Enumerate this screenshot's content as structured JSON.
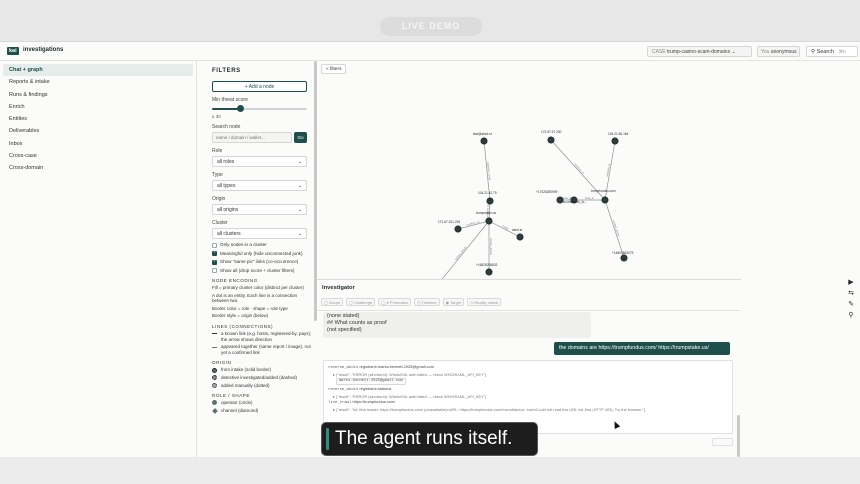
{
  "banner": {
    "pill_text": "LIVE DEMO"
  },
  "header": {
    "logo": "kai",
    "app_title": "investigations",
    "case_caption": "CASE",
    "case_value": "trump-casino-scam-domains",
    "case_chevron": "⌄",
    "user_caption": "You",
    "user_value": "anonymous",
    "search_label": "Search",
    "search_shortcut": "⌘K"
  },
  "nav": {
    "items": [
      "Chat + graph",
      "Reports & intake",
      "Runs & findings",
      "Enrich",
      "Entities",
      "Deliverables",
      "Inbox",
      "Cross-case",
      "Cross-domain"
    ],
    "active_index": 0
  },
  "filters": {
    "title": "FILTERS",
    "add_node": "+ Add a node",
    "min_threat_label": "Min threat score",
    "min_threat_value": 30,
    "min_threat_max": 100,
    "min_threat_readout": "≥ 30",
    "search_label": "Search node",
    "search_placeholder": "name / domain / wallet...",
    "go_label": "Go",
    "role_label": "Role",
    "role_value": "all roles",
    "type_label": "Type",
    "type_value": "all types",
    "origin_label": "Origin",
    "origin_value": "all origins",
    "cluster_label": "Cluster",
    "cluster_value": "all clusters",
    "checkboxes": [
      {
        "label": "Only nodes in a cluster",
        "checked": false
      },
      {
        "label": "Meaningful only (hide unconnected junk)",
        "checked": true
      },
      {
        "label": "Show \"same pic\" links (co-occurrence)",
        "checked": true
      },
      {
        "label": "Show all (drop score + cluster filters)",
        "checked": false
      }
    ],
    "encoding_title": "NODE ENCODING",
    "encoding_lines": [
      "Fill = primary cluster color (distinct per cluster)",
      "A dot is an entity. Each line is a connection between two.",
      "Border color = role · shape = role type",
      "Border style = origin (below)"
    ],
    "lines_title": "LINES (CONNECTIONS)",
    "lines_items": [
      "a known link (e.g. hosts, registered-by, pays); the arrow shows direction",
      "appeared together (same report / image), not yet a confirmed link"
    ],
    "origin_title": "ORIGIN",
    "origin_items": [
      "from intake (solid border)",
      "detective investigated/added (dashed)",
      "added manually (dotted)"
    ],
    "role_shape_title": "ROLE / SHAPE",
    "role_shape_items": [
      "operator (circle)",
      "channel (diamond)"
    ]
  },
  "graph": {
    "tab_label": "« filters",
    "nodes": [
      {
        "id": "n1",
        "label": "test@abcd.st"
      },
      {
        "id": "n2",
        "label": "172.67.97.230"
      },
      {
        "id": "n3",
        "label": "104.21.66.164"
      },
      {
        "id": "n4",
        "label": "trumpfundus.com"
      },
      {
        "id": "n5",
        "label": "+17028250999"
      },
      {
        "id": "n6",
        "label": "sn.escrituck_to..."
      },
      {
        "id": "n7",
        "label": "104.21.42.75"
      },
      {
        "id": "n8",
        "label": "trumpstake.us"
      },
      {
        "id": "n9",
        "label": "172.67.201.226"
      },
      {
        "id": "n10",
        "label": "abcd.st"
      },
      {
        "id": "n11",
        "label": "+14803563279"
      },
      {
        "id": "n12",
        "label": "+16852044170"
      },
      {
        "id": "n13",
        "label": "+16826208832"
      }
    ],
    "edges": [
      {
        "from": "n1",
        "to": "n7",
        "label": "registrant_email"
      },
      {
        "from": "n7",
        "to": "n8",
        "label": "resolves_to"
      },
      {
        "from": "n8",
        "to": "n9",
        "label": "resolves_to"
      },
      {
        "from": "n8",
        "to": "n10",
        "label": "hosts"
      },
      {
        "from": "n8",
        "to": "n12",
        "label": "contact_phone"
      },
      {
        "from": "n8",
        "to": "n13",
        "label": "contact_phone"
      },
      {
        "from": "n2",
        "to": "n4",
        "label": "resolves_to"
      },
      {
        "from": "n3",
        "to": "n4",
        "label": "resolves_to"
      },
      {
        "from": "n6",
        "to": "n4",
        "label": "links_to"
      },
      {
        "from": "n5",
        "to": "n6",
        "label": "same_pic"
      },
      {
        "from": "n4",
        "to": "n11",
        "label": "contact_phone"
      }
    ]
  },
  "rail": {
    "icons": [
      "▶",
      "⇆",
      "✎",
      "⚲"
    ]
  },
  "investigator": {
    "title": "Investigator",
    "tabs": [
      "▢ Scope",
      "▢ Challenge",
      "◯ ▾ Promotion",
      "◷ Timeline",
      "◉ Target",
      "◇ Reality check"
    ],
    "ai_lines": [
      "(none stated)",
      "## What counts as proof",
      "(not specified)"
    ],
    "user_message": "the domains are https://trumpfundus.com/    https://trumpstake.us/",
    "tool_lines": [
      {
        "kind": "call",
        "name": "reverse_whois",
        "text": "registrant=marks.bennett.2025@gmail.com"
      },
      {
        "kind": "res",
        "text": "▸ {\"result\": \"ERROR (whoisxml): WhoisXML auth failed — check WHOISXML_API_KEY\"}"
      },
      {
        "kind": "chip",
        "text": "marks.bennett.2025@gmail.com"
      },
      {
        "kind": "call",
        "name": "reverse_whois",
        "text": "registrant=stakeus"
      },
      {
        "kind": "res",
        "text": "▸ {\"result\": \"ERROR (whoisxml): WhoisXML auth failed — check WHOISXML_API_KEY\"}"
      },
      {
        "kind": "call",
        "name": "live_crawl",
        "text": "https://trumpfundus.com/"
      },
      {
        "kind": "res",
        "text": "▸ {\"result\": \"## Jina reader: https://trumpfundus.com/ (unavailable)\\nURL: https://trumpfundus.com/\\nconfidence: low\\nCould not read this URL via Jina (HTTP 403). Try the browser.\"}"
      }
    ]
  },
  "caption": {
    "text": "The agent runs itself."
  }
}
